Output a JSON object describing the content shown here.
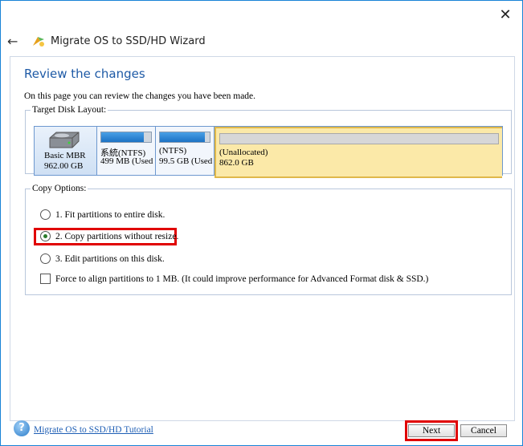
{
  "window": {
    "title": "Migrate OS to SSD/HD Wizard",
    "close_glyph": "✕",
    "back_glyph": "←"
  },
  "page": {
    "heading": "Review the changes",
    "subtitle": "On this page you can review the changes you have been made."
  },
  "target_disk_layout": {
    "legend": "Target Disk Layout:",
    "disk": {
      "type": "Basic MBR",
      "size": "962.00 GB"
    },
    "partitions": [
      {
        "name": "系統(NTFS)",
        "size": "499 MB (Used",
        "used_fraction": 0.85
      },
      {
        "name": "(NTFS)",
        "size": "99.5 GB (Used",
        "used_fraction": 0.9
      },
      {
        "name": "(Unallocated)",
        "size": "862.0 GB",
        "used_fraction": 0
      }
    ]
  },
  "copy_options": {
    "legend": "Copy Options:",
    "options": [
      {
        "label": "1. Fit partitions to entire disk.",
        "checked": false
      },
      {
        "label": "2. Copy partitions without resize.",
        "checked": true
      },
      {
        "label": "3. Edit partitions on this disk.",
        "checked": false
      }
    ],
    "align_checkbox": {
      "label": "Force to align partitions to 1 MB.  (It could improve performance for Advanced Format disk & SSD.)",
      "checked": false
    }
  },
  "footer": {
    "help_glyph": "?",
    "tutorial_link": "Migrate OS to SSD/HD Tutorial",
    "next_label": "Next",
    "cancel_label": "Cancel"
  },
  "colors": {
    "heading": "#1e5aa6",
    "highlight": "#e00000",
    "unallocated": "#fbe9a8",
    "partition_fill": "#1c72c4"
  }
}
